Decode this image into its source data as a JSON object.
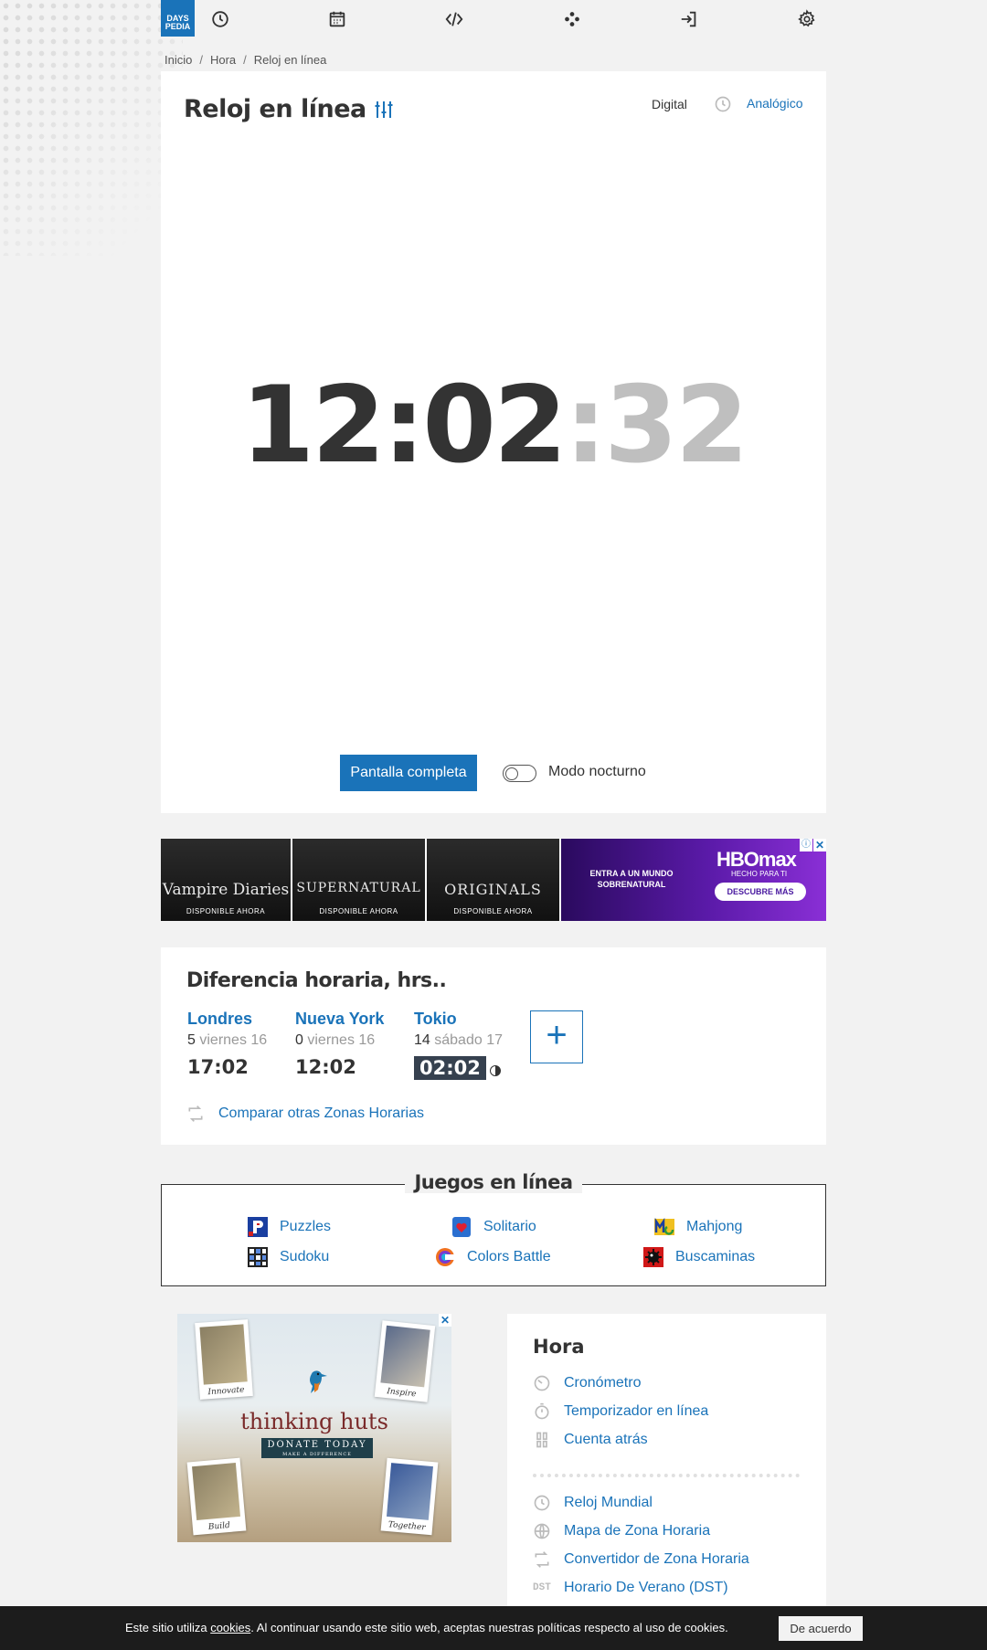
{
  "logo": {
    "line1": "DAYS",
    "line2": "PEDIA"
  },
  "nav": {
    "icons": [
      "clock-icon",
      "calendar-icon",
      "code-icon",
      "games-icon",
      "login-icon",
      "gear-icon"
    ]
  },
  "breadcrumb": [
    "Inicio",
    "Hora",
    "Reloj en línea"
  ],
  "breadcrumb_sep": "/",
  "main": {
    "title": "Reloj en línea",
    "mode_digital": "Digital",
    "mode_analog": "Analógico",
    "time_hm": "12:02",
    "time_sep": ":",
    "time_sec": "32",
    "fullscreen_label": "Pantalla completa",
    "night_mode_label": "Modo nocturno",
    "night_mode_on": false
  },
  "ad_banner": {
    "tiles": [
      {
        "title": "Vampire Diaries",
        "sub": "DISPONIBLE AHORA"
      },
      {
        "title": "SUPERNATURAL",
        "sub": "DISPONIBLE AHORA"
      },
      {
        "title": "ORIGINALS",
        "sub": "DISPONIBLE AHORA"
      }
    ],
    "hbo_text": "ENTRA A UN MUNDO SOBRENATURAL",
    "hbo_logo": "HBOmax",
    "hbo_sub": "HECHO PARA TI",
    "hbo_cta": "DESCUBRE MÁS"
  },
  "time_diff": {
    "title": "Diferencia horaria, hrs..",
    "cities": [
      {
        "name": "Londres",
        "offset": "5",
        "day": "viernes 16",
        "time": "17:02",
        "night": false
      },
      {
        "name": "Nueva York",
        "offset": "0",
        "day": "viernes 16",
        "time": "12:02",
        "night": false
      },
      {
        "name": "Tokio",
        "offset": "14",
        "day": "sábado 17",
        "time": "02:02",
        "night": true
      }
    ],
    "add_label": "+",
    "compare_label": "Comparar otras Zonas Horarias"
  },
  "games": {
    "title": "Juegos en línea",
    "items": [
      "Puzzles",
      "Solitario",
      "Mahjong",
      "Sudoku",
      "Colors Battle",
      "Buscaminas"
    ]
  },
  "huts_ad": {
    "title": "thinking huts",
    "donate": "DONATE TODAY",
    "donate_sub": "MAKE A DIFFERENCE",
    "captions": [
      "Innovate",
      "Inspire",
      "Build",
      "Together"
    ]
  },
  "sidebar": {
    "title": "Hora",
    "items_top": [
      "Cronómetro",
      "Temporizador en línea",
      "Cuenta atrás"
    ],
    "items_bottom": [
      "Reloj Mundial",
      "Mapa de Zona Horaria",
      "Convertidor de Zona Horaria",
      "Horario De Verano (DST)"
    ],
    "dst_label": "DST"
  },
  "cookie": {
    "text_before": "Este sitio utiliza ",
    "link": "cookies",
    "text_after": ". Al continuar usando este sitio web, aceptas nuestras políticas respecto al uso de cookies.",
    "button": "De acuerdo"
  },
  "colors": {
    "accent": "#1a73b9",
    "text": "#333333",
    "seconds": "#bfbfbf",
    "background": "#f2f2f2"
  }
}
